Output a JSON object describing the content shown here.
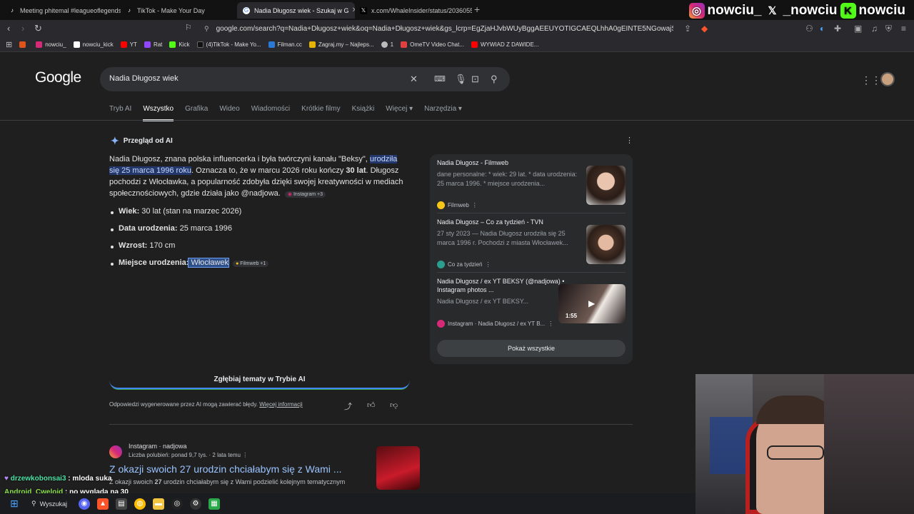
{
  "browser": {
    "tabs": [
      {
        "title": "Meeting phitemal #leagueoflegends",
        "color": "#111"
      },
      {
        "title": "TikTok - Make Your Day",
        "color": "#111"
      },
      {
        "title": "Nadia Długosz wiek - Szukaj w G",
        "color": "#4285f4",
        "active": true
      },
      {
        "title": "x.com/WhaleInsider/status/2036055",
        "color": "#111"
      }
    ],
    "new_tab": "+",
    "url": "google.com/search?q=Nadia+Długosz+wiek&oq=Nadia+Długosz+wiek&gs_lcrp=EgZjaHJvbWUyBggAEEUYOTIGCAEQLhhA0gEINTE5NGowajSoAgCwAgE...",
    "bookmarks": [
      {
        "label": "",
        "color": "#e0531b"
      },
      {
        "label": "nowciu_",
        "color": "#d62976"
      },
      {
        "label": "nowciu_kick",
        "color": "#ffffff"
      },
      {
        "label": "YT",
        "color": "#ff0000"
      },
      {
        "label": "Rat",
        "color": "#9146ff"
      },
      {
        "label": "Kick",
        "color": "#53fc18"
      },
      {
        "label": "(4)TikTok - Make Yo...",
        "color": "#111111"
      },
      {
        "label": "Filman.cc",
        "color": "#2a7ad5"
      },
      {
        "label": "Zagraj.my – Najleps...",
        "color": "#e5b300"
      },
      {
        "label": "1",
        "color": "#bbbbbb"
      },
      {
        "label": "OmeTV Video Chat...",
        "color": "#e04040"
      },
      {
        "label": "WYWIAD Z DAWIDE...",
        "color": "#ff0000"
      }
    ]
  },
  "social": {
    "instagram": "nowciu_",
    "x": "_nowciu",
    "kick": "nowciu"
  },
  "google": {
    "logo": "Google",
    "query": "Nadia Długosz wiek",
    "filters": [
      "Tryb AI",
      "Wszystko",
      "Grafika",
      "Wideo",
      "Wiadomości",
      "Krótkie filmy",
      "Książki",
      "Więcej ▾",
      "Narzędzia ▾"
    ],
    "active_filter": "Wszystko"
  },
  "ai": {
    "heading": "Przegląd od AI",
    "para_1": "Nadia Długosz, znana polska influencerka i była twórczyni kanału \"Beksy\", ",
    "para_hl": "urodziła się 25 marca 1996 roku",
    "para_2": ". Oznacza to, że w marcu 2026 roku kończy ",
    "para_bold": "30 lat",
    "para_3": ". Długosz pochodzi z Włocławka, a popularność zdobyła dzięki swojej kreatywności w mediach społecznościowych, gdzie działa jako @nadjowa.",
    "para_chip": "Instagram +3",
    "facts": [
      {
        "label": "Wiek:",
        "value": " 30 lat (stan na marzec 2026)"
      },
      {
        "label": "Data urodzenia:",
        "value": " 25 marca 1996"
      },
      {
        "label": "Wzrost:",
        "value": " 170 cm"
      },
      {
        "label": "Miejsce urodzenia:",
        "value": " Włocławek",
        "chip": "Filmweb +1"
      }
    ],
    "sources": [
      {
        "title": "Nadia Długosz - Filmweb",
        "desc": "dane personalne: * wiek: 29 lat. * data urodzenia: 25 marca 1996. * miejsce urodzenia...",
        "site": "Filmweb",
        "dot": "#f5c518"
      },
      {
        "title": "Nadia Długosz – Co za tydzień - TVN",
        "desc": "27 sty 2023 — Nadia Długosz urodziła się 25 marca 1996 r. Pochodzi z miasta Włocławek...",
        "site": "Co za tydzień",
        "dot": "#2a9d8f"
      },
      {
        "title": "Nadia Długosz / ex YT BEKSY (@nadjowa) • Instagram photos ...",
        "desc": "Nadia Długosz / ex YT BEKSY...",
        "site": "Instagram · Nadia Długosz / ex YT B...",
        "dot": "#d62976",
        "duration": "1:55"
      }
    ],
    "show_all": "Pokaż wszystkie",
    "deep_dive": "Zgłębiaj tematy w Trybie AI",
    "disclaimer": "Odpowiedzi wygenerowane przez AI mogą zawierać błędy. ",
    "disclaimer_link": "Więcej informacji"
  },
  "result": {
    "site": "Instagram · nadjowa",
    "meta": "Liczba polubień: ponad 9,7 tys. · 2 lata temu",
    "title": "Z okazji swoich 27 urodzin chciałabym się z Wami ...",
    "snippet_pre": "Z okazji swoich ",
    "snippet_bold": "27",
    "snippet_post": " urodzin chciałabym się z Wami podzielić kolejnym tematycznym"
  },
  "chat": [
    {
      "user": "drzewkobonsai3",
      "msg": "mloda suka",
      "color": "#4de1a5"
    },
    {
      "user": "Android_Cweloid",
      "msg": "no wyglada na 30",
      "color": "#8be04e"
    }
  ],
  "taskbar": {
    "search": "Wyszukaj"
  }
}
